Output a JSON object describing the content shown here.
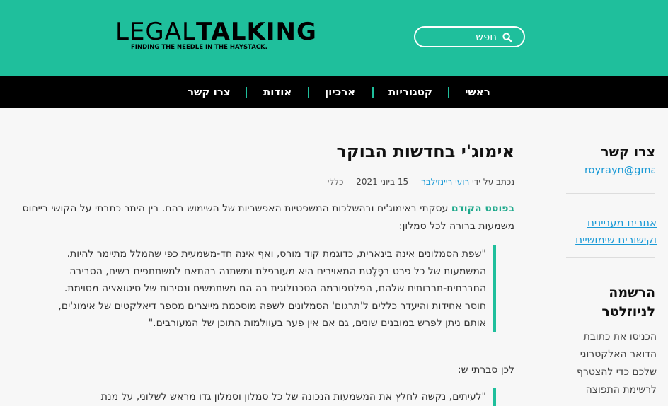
{
  "brand": {
    "name_light": "LEGAL",
    "name_bold": "TALKING",
    "tagline": "FINDING THE NEEDLE IN THE HAYSTACK."
  },
  "search": {
    "placeholder": "חפש",
    "icon": "search-icon"
  },
  "nav": {
    "items": [
      "ראשי",
      "קטגוריות",
      "ארכיון",
      "אודות",
      "צרו קשר"
    ]
  },
  "article": {
    "title": "אימוג'י בחדשות הבוקר",
    "meta": {
      "prefix": "נכתב על ידי",
      "author": "רועי ריינזילבר",
      "date": "15 ביוני 2021",
      "category": "כללי"
    },
    "intro_link": "בפוסט הקודם",
    "intro_rest": " עסקתי באימוג'ים ובהשלכות המשפטיות האפשריות של השימוש בהם. בין היתר כתבתי על הקושי בייחוס משמעות ברורה לכל סמלון:",
    "quote": "\"שפת הסמלונים אינה בינארית, כדוגמת קוד מורס, ואף אינה חד-משמעית כפי שהמלל מתיימר להיות. המשמעות של כל פרט בפָּלֶטת המאוירים היא מעורפלת ומשתנה בהתאם למשתתפים בשיח, הסביבה החברתית-תרבותית שלהם, הפלטפורמה הטכנולוגית בה הם משתמשים ונסיבות של סיטואציה מסוימת. חוסר אחידות והיעדר כללים ל'תרגום' הסמלונים לשפה מוסכמת מייצרים מספר דיאלקטים של אימוג'ים, אותם ניתן לפרש במובנים שונים, גם אם אין פער בעוולמות התוכן של המעורבים.\"",
    "conclusion": "לכן סברתי ש:",
    "quote2_start": "\"לעיתים, נקשה לחלץ את המשמעות הנכונה של כל סמלון וסמלון גדו מראש לשלוני, על מנת"
  },
  "sidebar": {
    "contact_title": "צרו קשר",
    "email": "royrayn@gmail.com",
    "links": [
      "אתרים מעניינים",
      "וקישורים שימושיים"
    ],
    "newsletter_title_1": "הרשמה",
    "newsletter_title_2": "לניוזלטר",
    "newsletter_text": "הכניסו את כתובת הדואר האלקטרוני שלכם כדי להצטרף לרשימת התפוצה"
  },
  "colors": {
    "accent": "#1fbf9c",
    "nav_bg": "#000000",
    "link": "#1a9ad6"
  }
}
